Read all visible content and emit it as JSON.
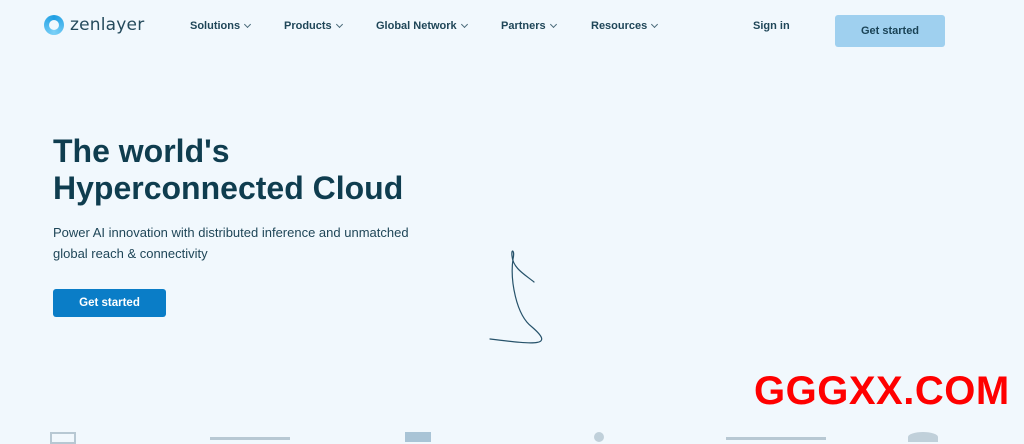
{
  "nav": {
    "logo_text": "zenlayer",
    "items": [
      {
        "label": "Solutions"
      },
      {
        "label": "Products"
      },
      {
        "label": "Global Network"
      },
      {
        "label": "Partners"
      },
      {
        "label": "Resources"
      }
    ],
    "sign_in": "Sign in",
    "cta": "Get started"
  },
  "hero": {
    "title_line1": "The world's",
    "title_line2": "Hyperconnected Cloud",
    "subtitle": "Power AI innovation with distributed inference and unmatched global reach & connectivity",
    "cta": "Get started"
  },
  "watermark": "GGGXX.COM",
  "colors": {
    "background": "#f1f8fd",
    "primary_button": "#0a7dc7",
    "nav_button": "#9fd0ef",
    "heading": "#0f3d4f",
    "watermark": "#ff0000"
  },
  "icons": {
    "logo": "zenlayer-ring-logo",
    "dropdown": "chevron-down-icon"
  }
}
